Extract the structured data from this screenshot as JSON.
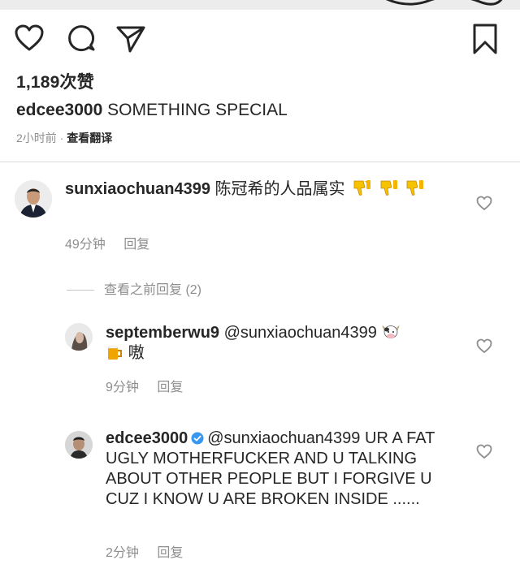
{
  "post": {
    "likes": "1,189次赞",
    "caption_user": "edcee3000",
    "caption_text": "SOMETHING SPECIAL",
    "time": "2小时前",
    "separator": "·",
    "translate": "查看翻译"
  },
  "comments": [
    {
      "user": "sunxiaochuan4399",
      "text": "陈冠希的人品属实",
      "time": "49分钟",
      "reply": "回复"
    }
  ],
  "view_previous": "查看之前回复 (2)",
  "replies": [
    {
      "user": "septemberwu9",
      "mention": "@sunxiaochuan4399",
      "text": "嗷",
      "time": "9分钟",
      "reply": "回复"
    },
    {
      "user": "edcee3000",
      "mention": "@sunxiaochuan4399",
      "text": "UR A FAT UGLY MOTHERFUCKER AND U TALKING ABOUT OTHER PEOPLE BUT I FORGIVE U CUZ I KNOW U ARE BROKEN INSIDE ......",
      "time": "2分钟",
      "reply": "回复"
    }
  ],
  "colors": {
    "text": "#262626",
    "secondary": "#8e8e8e",
    "verified": "#3897f0",
    "thumb": "#f5b400"
  },
  "icons": [
    "heart-icon",
    "comment-icon",
    "share-icon",
    "bookmark-icon",
    "thumbs-down-emoji",
    "cow-emoji",
    "beer-emoji",
    "verified-badge-icon"
  ]
}
